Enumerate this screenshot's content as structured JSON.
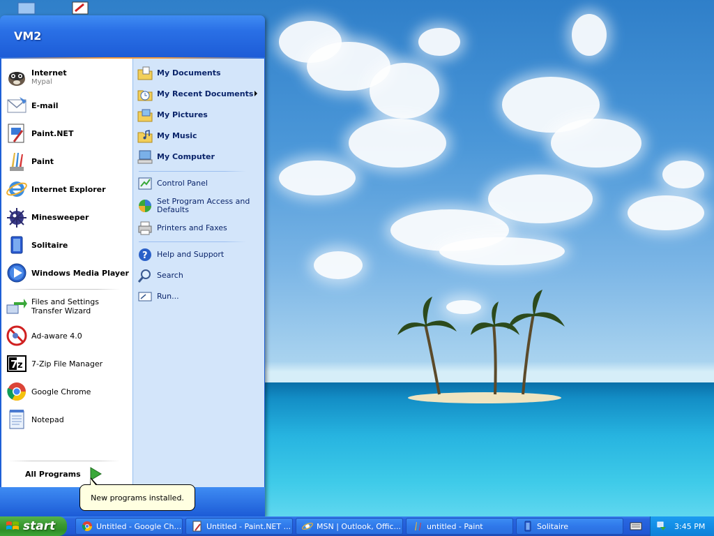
{
  "start_menu": {
    "user_name": "VM2",
    "pinned": [
      {
        "name": "Internet",
        "sub": "Mypal",
        "icon": "mypal-icon"
      },
      {
        "name": "E-mail",
        "sub": "",
        "icon": "email-icon"
      }
    ],
    "recent": [
      {
        "name": "Paint.NET",
        "icon": "paint-net-icon"
      },
      {
        "name": "Paint",
        "icon": "paint-icon"
      },
      {
        "name": "Internet Explorer",
        "icon": "internet-explorer-icon"
      },
      {
        "name": "Minesweeper",
        "icon": "minesweeper-icon"
      },
      {
        "name": "Solitaire",
        "icon": "solitaire-icon"
      },
      {
        "name": "Windows Media Player",
        "icon": "media-player-icon"
      },
      {
        "name": "Files and Settings Transfer Wizard",
        "icon": "transfer-wizard-icon"
      },
      {
        "name": "Ad-aware 4.0",
        "icon": "ad-aware-icon"
      },
      {
        "name": "7-Zip File Manager",
        "icon": "seven-zip-icon"
      },
      {
        "name": "Google Chrome",
        "icon": "chrome-icon"
      },
      {
        "name": "Notepad",
        "icon": "notepad-icon"
      }
    ],
    "all_programs": "All Programs",
    "places": [
      {
        "name": "My Documents",
        "icon": "folder-documents-icon"
      },
      {
        "name": "My Recent Documents",
        "icon": "recent-documents-icon"
      },
      {
        "name": "My Pictures",
        "icon": "folder-pictures-icon"
      },
      {
        "name": "My Music",
        "icon": "folder-music-icon"
      },
      {
        "name": "My Computer",
        "icon": "computer-icon"
      }
    ],
    "settings": [
      {
        "name": "Control Panel",
        "icon": "control-panel-icon"
      },
      {
        "name": "Set Program Access and Defaults",
        "icon": "program-access-icon"
      },
      {
        "name": "Printers and Faxes",
        "icon": "printer-icon"
      }
    ],
    "tools": [
      {
        "name": "Help and Support",
        "icon": "help-icon"
      },
      {
        "name": "Search",
        "icon": "search-icon"
      },
      {
        "name": "Run...",
        "icon": "run-icon"
      }
    ]
  },
  "balloon": {
    "text": "New programs installed."
  },
  "taskbar": {
    "start_label": "start",
    "tasks": [
      {
        "label": "Untitled - Google Chr...",
        "icon": "chrome-icon"
      },
      {
        "label": "Untitled - Paint.NET ...",
        "icon": "paint-net-icon"
      },
      {
        "label": "MSN | Outlook, Offic...",
        "icon": "internet-explorer-icon"
      },
      {
        "label": "untitled - Paint",
        "icon": "paint-icon"
      },
      {
        "label": "Solitaire",
        "icon": "solitaire-icon"
      }
    ],
    "clock": "3:45 PM"
  },
  "colors": {
    "xp_blue": "#245fdb",
    "start_green": "#3c9a32",
    "right_pane": "#d3e5fa",
    "tray_blue": "#128ee6",
    "balloon_bg": "#ffffe1"
  }
}
